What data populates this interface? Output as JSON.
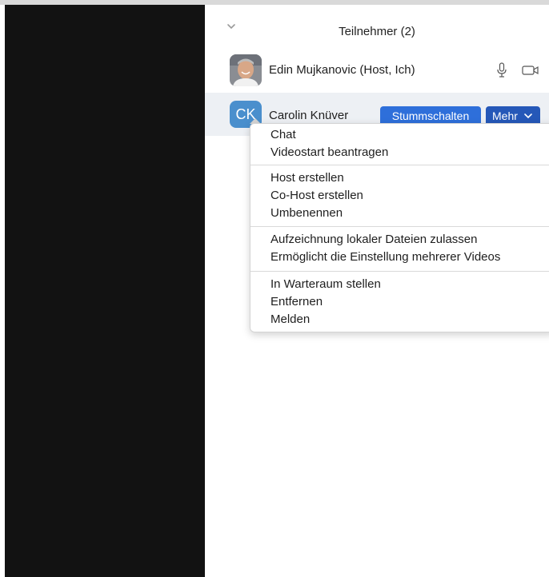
{
  "panel": {
    "title": "Teilnehmer (2)"
  },
  "participants": [
    {
      "name": "Edin Mujkanovic (Host, Ich)",
      "avatar": "photo"
    },
    {
      "name": "Carolin Knüver",
      "initials": "CK",
      "mute_label": "Stummschalten",
      "more_label": "Mehr"
    }
  ],
  "menu": {
    "groups": [
      [
        "Chat",
        "Videostart beantragen"
      ],
      [
        "Host erstellen",
        "Co-Host erstellen",
        "Umbenennen"
      ],
      [
        "Aufzeichnung lokaler Dateien zulassen",
        "Ermöglicht die Einstellung mehrerer Videos"
      ],
      [
        "In Warteraum stellen",
        "Entfernen",
        "Melden"
      ]
    ]
  },
  "icons": {
    "collapse": "chevron-down-icon",
    "mic": "microphone-icon",
    "camera": "video-camera-icon",
    "more": "chevron-down-icon"
  },
  "colors": {
    "video_background": "#121212",
    "mute_button": "#2e6fda",
    "more_button": "#2558b8",
    "selected_row": "#edf0f4",
    "avatar_ck": "#4a8fcd"
  }
}
